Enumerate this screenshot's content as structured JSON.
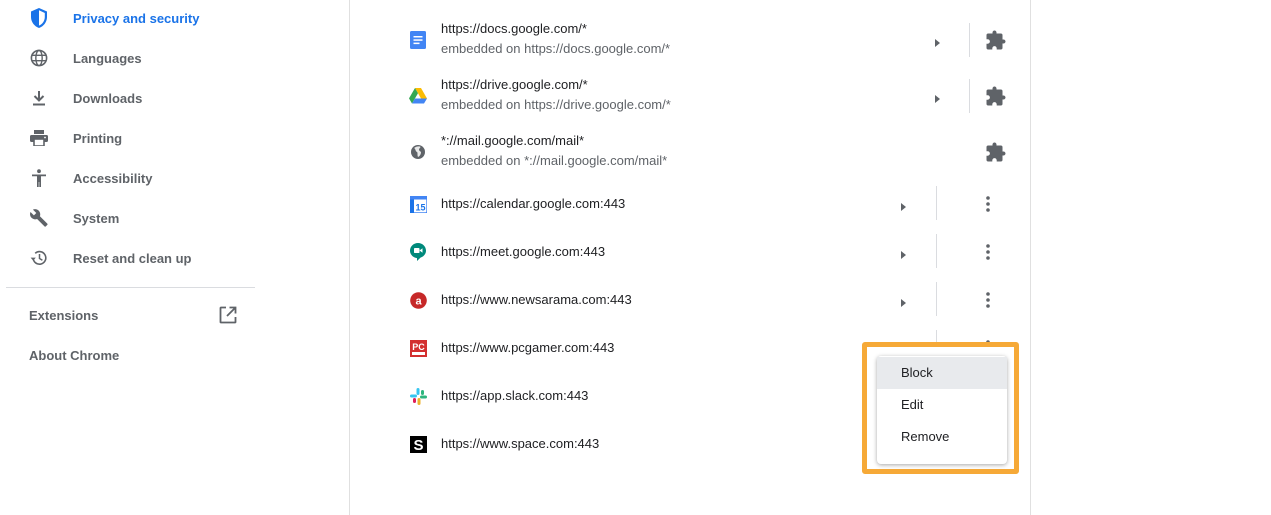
{
  "sidebar": {
    "items": [
      {
        "label": "Privacy and security",
        "icon": "shield-icon",
        "active": true
      },
      {
        "label": "Languages",
        "icon": "globe-icon"
      },
      {
        "label": "Downloads",
        "icon": "download-icon"
      },
      {
        "label": "Printing",
        "icon": "printer-icon"
      },
      {
        "label": "Accessibility",
        "icon": "accessibility-icon"
      },
      {
        "label": "System",
        "icon": "wrench-icon"
      },
      {
        "label": "Reset and clean up",
        "icon": "history-icon"
      }
    ],
    "extensions_label": "Extensions",
    "about_label": "About Chrome"
  },
  "sites": [
    {
      "url": "https://docs.google.com/*",
      "sub": "embedded on https://docs.google.com/*",
      "icon": "google-docs-icon",
      "action": "puzzle-icon"
    },
    {
      "url": "https://drive.google.com/*",
      "sub": "embedded on https://drive.google.com/*",
      "icon": "google-drive-icon",
      "action": "puzzle-icon"
    },
    {
      "url": "*://mail.google.com/mail*",
      "sub": "embedded on *://mail.google.com/mail*",
      "icon": "globe-icon",
      "action": "puzzle-icon"
    },
    {
      "url": "https://calendar.google.com:443",
      "icon": "google-calendar-icon",
      "action": "more-vert-icon"
    },
    {
      "url": "https://meet.google.com:443",
      "icon": "google-meet-icon",
      "action": "more-vert-icon"
    },
    {
      "url": "https://www.newsarama.com:443",
      "icon": "newsarama-icon",
      "action": "more-vert-icon"
    },
    {
      "url": "https://www.pcgamer.com:443",
      "icon": "pcgamer-icon",
      "action": "more-vert-icon"
    },
    {
      "url": "https://app.slack.com:443",
      "icon": "slack-icon"
    },
    {
      "url": "https://www.space.com:443",
      "icon": "space-icon"
    }
  ],
  "context_menu": {
    "items": [
      "Block",
      "Edit",
      "Remove"
    ],
    "hovered": "Block"
  },
  "colors": {
    "accent": "#1a73e8",
    "highlight": "#f6a937",
    "text_secondary": "#5f6368"
  }
}
